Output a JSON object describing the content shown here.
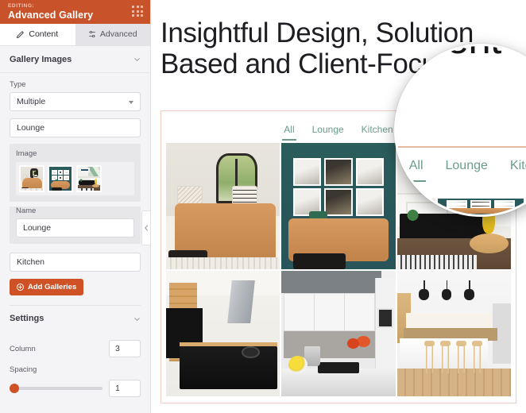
{
  "panel": {
    "eyebrow": "EDITING:",
    "title": "Advanced Gallery",
    "grip_icon": "grid-dots-icon",
    "tabs": [
      {
        "label": "Content",
        "icon": "pencil-icon",
        "active": true
      },
      {
        "label": "Advanced",
        "icon": "sliders-icon",
        "active": false
      }
    ],
    "sections": {
      "gallery_images": {
        "title": "Gallery Images",
        "chevron_icon": "chevron-down-icon",
        "type_label": "Type",
        "type_value": "Multiple",
        "type_options": [
          "Multiple"
        ],
        "gallery1_title": "Lounge",
        "image_label": "Image",
        "name_label": "Name",
        "name_value": "Lounge",
        "gallery2_title": "Kitchen",
        "add_button": "Add Galleries",
        "add_button_icon": "plus-circle-icon"
      },
      "settings": {
        "title": "Settings",
        "chevron_icon": "chevron-down-icon",
        "column_label": "Column",
        "column_value": "3",
        "spacing_label": "Spacing",
        "spacing_value": "1"
      }
    },
    "collapse_icon": "chevron-left-icon"
  },
  "canvas": {
    "heading_line1": "Insightful Design, Solution",
    "heading_line2": "Based and Client-Focused",
    "filters": [
      {
        "label": "All",
        "active": true
      },
      {
        "label": "Lounge",
        "active": false
      },
      {
        "label": "Kitchen",
        "active": false
      }
    ],
    "gallery": [
      {
        "alt": "lounge-with-arched-mirror"
      },
      {
        "alt": "lounge-teal-wall-frame-gallery"
      },
      {
        "alt": "lounge-black-sideboard-palm-wallpaper"
      },
      {
        "alt": "kitchen-dark-wood-island"
      },
      {
        "alt": "kitchen-white-cabinets-lemons"
      },
      {
        "alt": "kitchen-white-island-bar-stools"
      }
    ]
  },
  "lens": {
    "magnified_text": "and Client-",
    "filters": [
      {
        "label": "All",
        "active": true
      },
      {
        "label": "Lounge",
        "active": false
      },
      {
        "label": "Kitchen",
        "active": false
      }
    ]
  },
  "colors": {
    "header_orange": "#c8532b",
    "button_orange": "#cf5227",
    "filter_teal": "#6b9c8a",
    "widget_border": "#f0cfc0",
    "sidebar_bg": "#f4f4f6"
  }
}
